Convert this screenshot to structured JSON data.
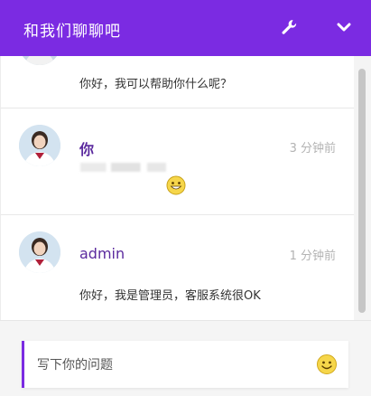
{
  "header": {
    "title": "和我们聊聊吧",
    "wrench_icon": "wrench-icon",
    "collapse_icon": "chevron-down-icon",
    "bg_color": "#7b2be2"
  },
  "messages": [
    {
      "text": "你好，我可以帮助你什么呢？"
    },
    {
      "sender": "你",
      "time": "3 分钟前",
      "emoji": "smiley-icon"
    },
    {
      "sender": "admin",
      "time": "1 分钟前",
      "text": "你好，我是管理员，客服系统很OK"
    }
  ],
  "composer": {
    "placeholder": "写下你的问题",
    "emoji_icon": "smiley-icon"
  }
}
